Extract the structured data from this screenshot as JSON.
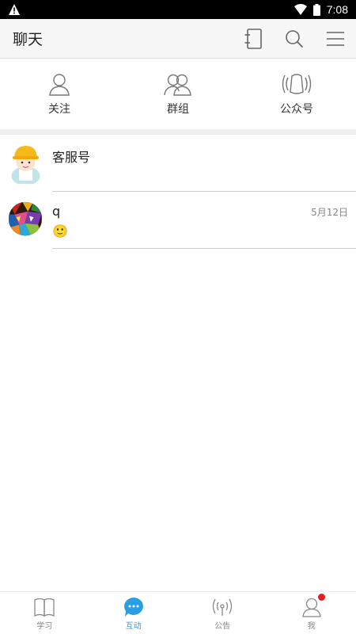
{
  "status_bar": {
    "time": "7:08"
  },
  "header": {
    "title": "聊天"
  },
  "quick_links": [
    {
      "label": "关注",
      "icon": "person-icon"
    },
    {
      "label": "群组",
      "icon": "group-icon"
    },
    {
      "label": "公众号",
      "icon": "broadcast-icon"
    }
  ],
  "chats": [
    {
      "name": "客服号",
      "date": "",
      "message": "",
      "avatar": "worker-avatar"
    },
    {
      "name": "q",
      "date": "5月12日",
      "message": "🙂",
      "avatar": "mosaic-avatar"
    }
  ],
  "tabs": [
    {
      "label": "学习",
      "icon": "book-icon",
      "active": false
    },
    {
      "label": "互动",
      "icon": "chat-bubble-icon",
      "active": true
    },
    {
      "label": "公告",
      "icon": "antenna-icon",
      "active": false
    },
    {
      "label": "我",
      "icon": "user-icon",
      "active": false,
      "badge": true
    }
  ],
  "colors": {
    "accent": "#2a9ee5",
    "badge": "#e02020"
  }
}
